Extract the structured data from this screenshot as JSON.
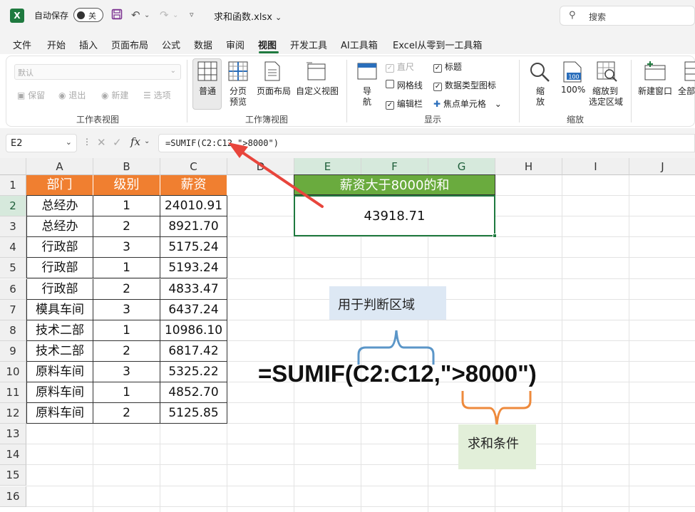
{
  "app": {
    "autosave_label": "自动保存",
    "autosave_state": "关",
    "filename": "求和函数.xlsx",
    "search_placeholder": "搜索",
    "brand_color": "#1f7a3f"
  },
  "menu": [
    "文件",
    "开始",
    "插入",
    "页面布局",
    "公式",
    "数据",
    "审阅",
    "视图",
    "开发工具",
    "AI工具箱",
    "Excel从零到一工具箱"
  ],
  "menu_active": "视图",
  "ribbon": {
    "sheetview": {
      "dropdown": "默认",
      "keep": "保留",
      "exit": "退出",
      "new": "新建",
      "options": "选项",
      "label": "工作表视图"
    },
    "workbookview": {
      "normal": "普通",
      "pagebreak_1": "分页",
      "pagebreak_2": "预览",
      "pagelayout": "页面布局",
      "custom": "自定义视图",
      "label": "工作簿视图"
    },
    "show": {
      "nav_1": "导",
      "nav_2": "航",
      "ruler": "直尺",
      "gridlines": "网格线",
      "formulabar": "编辑栏",
      "headings": "标题",
      "datatype_icons": "数据类型图标",
      "focus_cell": "焦点单元格",
      "label": "显示"
    },
    "zoom": {
      "zoom_1": "缩",
      "zoom_2": "放",
      "hundred": "100%",
      "tosel_1": "缩放到",
      "tosel_2": "选定区域",
      "label": "缩放"
    },
    "window": {
      "newwin": "新建窗口",
      "all": "全部"
    }
  },
  "formula_bar": {
    "namebox": "E2",
    "fx": "fx",
    "formula": "=SUMIF(C2:C12,\">8000\")"
  },
  "columns": [
    "A",
    "B",
    "C",
    "D",
    "E",
    "F",
    "G",
    "H",
    "I",
    "J"
  ],
  "rows": [
    "1",
    "2",
    "3",
    "4",
    "5",
    "6",
    "7",
    "8",
    "9",
    "10",
    "11",
    "12",
    "13",
    "14",
    "15",
    "16"
  ],
  "table": {
    "headers": [
      "部门",
      "级别",
      "薪资"
    ],
    "rows": [
      [
        "总经办",
        "1",
        "24010.91"
      ],
      [
        "总经办",
        "2",
        "8921.70"
      ],
      [
        "行政部",
        "3",
        "5175.24"
      ],
      [
        "行政部",
        "1",
        "5193.24"
      ],
      [
        "行政部",
        "2",
        "4833.47"
      ],
      [
        "模具车间",
        "3",
        "6437.24"
      ],
      [
        "技术二部",
        "1",
        "10986.10"
      ],
      [
        "技术二部",
        "2",
        "6817.42"
      ],
      [
        "原料车间",
        "3",
        "5325.22"
      ],
      [
        "原料车间",
        "1",
        "4852.70"
      ],
      [
        "原料车间",
        "2",
        "5125.85"
      ]
    ],
    "header_color": "#f07f30"
  },
  "result": {
    "title": "薪资大于8000的和",
    "value": "43918.71",
    "title_color": "#6aab3e"
  },
  "annotations": {
    "range_label": "用于判断区域",
    "range_label_color": "#dde8f4",
    "big_formula": "=SUMIF(C2:C12,\">8000\")",
    "criteria_label": "求和条件",
    "criteria_label_color": "#e2efd9",
    "arrow_color": "#e8453c"
  }
}
